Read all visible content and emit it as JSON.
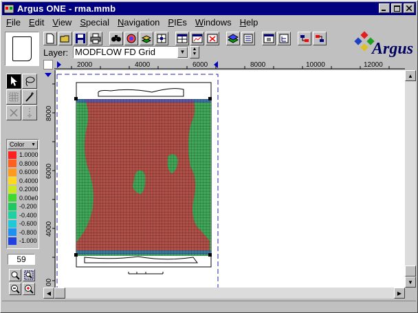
{
  "window": {
    "title": "Argus ONE - rma.mmb"
  },
  "title_buttons": [
    "minimize",
    "maximize",
    "close"
  ],
  "menu": [
    {
      "label": "File",
      "key": "F",
      "rest": "ile"
    },
    {
      "label": "Edit",
      "key": "E",
      "rest": "dit"
    },
    {
      "label": "View",
      "key": "V",
      "rest": "iew"
    },
    {
      "label": "Special",
      "key": "S",
      "rest": "pecial"
    },
    {
      "label": "Navigation",
      "key": "N",
      "rest": "avigation"
    },
    {
      "label": "PIEs",
      "key": "P",
      "rest": "IEs"
    },
    {
      "label": "Windows",
      "key": "W",
      "rest": "indows"
    },
    {
      "label": "Help",
      "key": "H",
      "rest": "elp"
    }
  ],
  "toolbar_icons": [
    "new-icon",
    "open-icon",
    "save-icon",
    "print-icon",
    "find-icon",
    "color-icon",
    "layers-icon",
    "grid-icon",
    "table-icon",
    "chart-icon",
    "delete-icon",
    "export-icon",
    "import-icon",
    "window-icon",
    "tree-icon",
    "run-icon"
  ],
  "logo": {
    "text": "Argus"
  },
  "layer": {
    "label": "Layer:",
    "value": "MODFLOW FD Grid"
  },
  "ruler": {
    "h_labels": [
      "2000",
      "4000",
      "6000",
      "8000",
      "10000",
      "12000"
    ],
    "v_labels": [
      "8000",
      "6000",
      "4000",
      "00"
    ]
  },
  "palette_icons": [
    "arrow-icon",
    "lasso-icon",
    "grid-select-icon",
    "magic-wand-icon",
    "cross-icon",
    "vertical-line-icon"
  ],
  "color_panel": {
    "select_label": "Color",
    "legend": [
      {
        "label": "1.0000",
        "color": "#ff2020"
      },
      {
        "label": "0.8000",
        "color": "#ff6020"
      },
      {
        "label": "0.6000",
        "color": "#ff9a20"
      },
      {
        "label": "0.4000",
        "color": "#ffd820"
      },
      {
        "label": "0.2000",
        "color": "#c8e820"
      },
      {
        "label": "0.00e0",
        "color": "#40d830"
      },
      {
        "label": "-0.200",
        "color": "#20c860"
      },
      {
        "label": "-0.400",
        "color": "#20d0a0"
      },
      {
        "label": "-0.600",
        "color": "#20c8d8"
      },
      {
        "label": "-0.800",
        "color": "#2090f0"
      },
      {
        "label": "-1.000",
        "color": "#2040e0"
      }
    ]
  },
  "number_field": "59",
  "zoom_icons": [
    "zoom-icon",
    "zoom-fit-icon",
    "zoom-out-icon",
    "zoom-in-icon"
  ],
  "colors": {
    "titlebar": "#000080",
    "grid_red": "#b05048",
    "grid_green": "#40a858",
    "grid_blue": "#3858c8"
  }
}
